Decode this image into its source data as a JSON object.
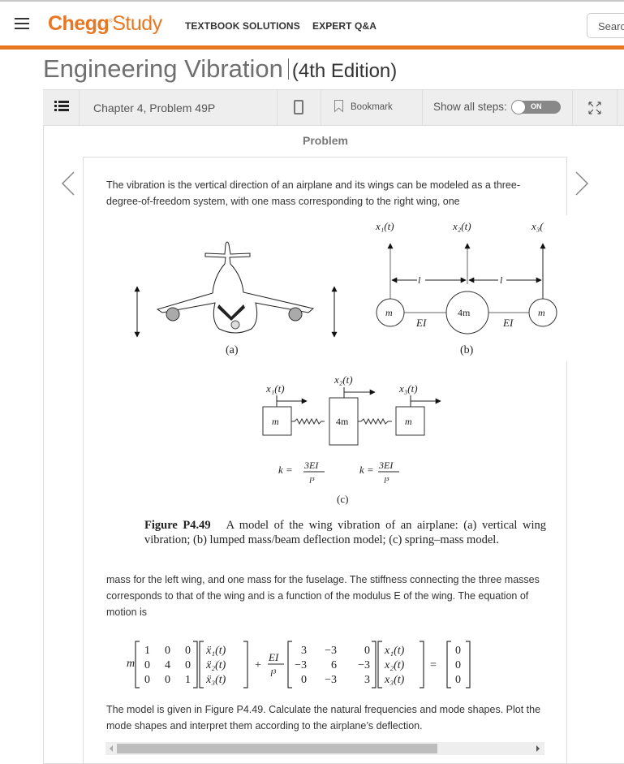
{
  "header": {
    "brand_bold": "Chegg",
    "brand_reg": "®",
    "brand_light": "Study",
    "nav": [
      "TEXTBOOK SOLUTIONS",
      "EXPERT Q&A"
    ],
    "search_placeholder": "Search"
  },
  "book": {
    "title": "Engineering Vibration",
    "edition": "(4th Edition)"
  },
  "toolbar": {
    "chapter_problem": "Chapter 4, Problem 49P",
    "bookmark_label": "Bookmark",
    "show_all_steps_label": "Show all steps:",
    "toggle_state": "ON"
  },
  "problem": {
    "heading": "Problem",
    "intro": "The vibration is the vertical direction of an airplane and its wings can be modeled as a three-degree-of-freedom system, with one mass corresponding to the right wing, one",
    "middle": "mass for the left wing, and one mass for the fuselage. The stiffness connecting the three masses corresponds to that of the wing and is a function of the modulus E of the wing. The equation of motion is",
    "closing": "The model is given in Figure P4.49. Calculate the natural frequencies and mode shapes. Plot the mode shapes and interpret them according to the airplane’s deflection."
  },
  "figure": {
    "caption_label": "Figure P4.49",
    "caption_text": "A model of the wing vibration of an airplane: (a) vertical wing vibration; (b) lumped mass/beam deflection model; (c) spring–mass model.",
    "panel_a_label": "(a)",
    "panel_b_label": "(b)",
    "panel_c_label": "(c)",
    "b": {
      "x1": "x₁(t)",
      "x2": "x₂(t)",
      "x3": "x₃(",
      "len": "l",
      "mass_left": "m",
      "mass_center": "4m",
      "mass_right": "m",
      "beam": "EI"
    },
    "c": {
      "x1": "x₁(t)",
      "x2": "x₂(t)",
      "x3": "x₃(t)",
      "mass_left": "m",
      "mass_center": "4m",
      "mass_right": "m",
      "k_lhs": "k =",
      "k_num": "3EI",
      "k_den": "l³"
    }
  },
  "equation": {
    "mass_coef": "m",
    "mass_matrix": [
      [
        "1",
        "0",
        "0"
      ],
      [
        "0",
        "4",
        "0"
      ],
      [
        "0",
        "0",
        "1"
      ]
    ],
    "accel_vector": [
      "ẍ₁(t)",
      "ẍ₂(t)",
      "ẍ₃(t)"
    ],
    "stiff_num": "EI",
    "stiff_den": "l³",
    "stiff_matrix": [
      [
        "3",
        "−3",
        "0"
      ],
      [
        "−3",
        "6",
        "−3"
      ],
      [
        "0",
        "−3",
        "3"
      ]
    ],
    "disp_vector": [
      "x₁(t)",
      "x₂(t)",
      "x₃(t)"
    ],
    "rhs": [
      "0",
      "0",
      "0"
    ],
    "plus": "+",
    "equals": "="
  },
  "colors": {
    "brand_orange": "#e87722",
    "toolbar_bg": "#eeeeee",
    "toggle_bg": "#888888"
  }
}
